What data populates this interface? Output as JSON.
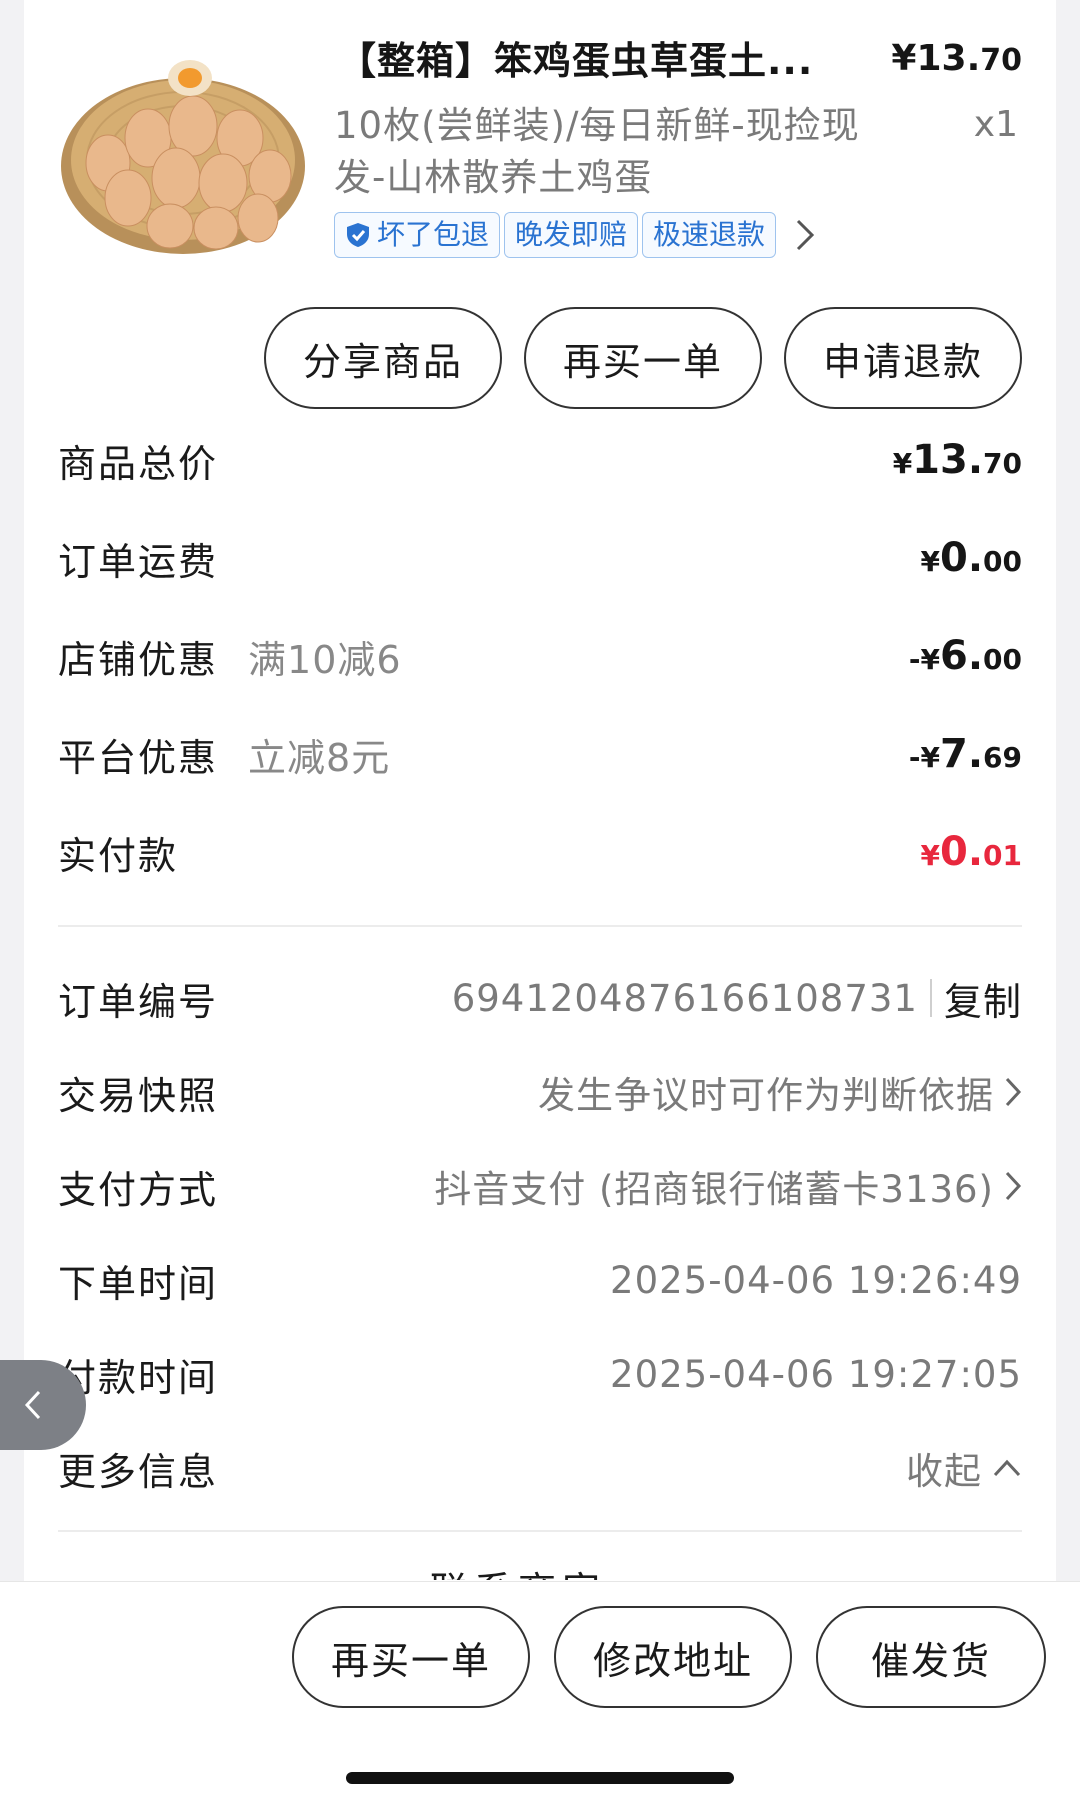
{
  "product": {
    "title": "【整箱】笨鸡蛋虫草蛋土...",
    "price_int": "¥13.",
    "price_dec": "70",
    "spec": "10枚(尝鲜装)/每日新鲜-现捡现发-山林散养土鸡蛋",
    "qty": "x1",
    "tags": [
      "坏了包退",
      "晚发即赔",
      "极速退款"
    ]
  },
  "actions": {
    "share": "分享商品",
    "rebuy": "再买一单",
    "refund": "申请退款"
  },
  "price_rows": [
    {
      "label": "商品总价",
      "sub": "",
      "sign": "",
      "sym": "¥",
      "int": "13.",
      "dec": "70"
    },
    {
      "label": "订单运费",
      "sub": "",
      "sign": "",
      "sym": "¥",
      "int": "0.",
      "dec": "00"
    },
    {
      "label": "店铺优惠",
      "sub": "满10减6",
      "sign": "-",
      "sym": "¥",
      "int": "6.",
      "dec": "00"
    },
    {
      "label": "平台优惠",
      "sub": "立减8元",
      "sign": "-",
      "sym": "¥",
      "int": "7.",
      "dec": "69"
    },
    {
      "label": "实付款",
      "sub": "",
      "sign": "",
      "sym": "¥",
      "int": "0.",
      "dec": "01"
    }
  ],
  "info_rows": {
    "order_no_label": "订单编号",
    "order_no": "6941204876166108731",
    "copy": "复制",
    "snapshot_label": "交易快照",
    "snapshot_value": "发生争议时可作为判断依据",
    "pay_method_label": "支付方式",
    "pay_method_value": "抖音支付 (招商银行储蓄卡3136)",
    "order_time_label": "下单时间",
    "order_time": "2025-04-06 19:26:49",
    "pay_time_label": "付款时间",
    "pay_time": "2025-04-06 19:27:05",
    "more_label": "更多信息",
    "collapse": "收起"
  },
  "contact_partial": "联系商家",
  "bottom": {
    "rebuy": "再买一单",
    "edit_address": "修改地址",
    "urge": "催发货"
  },
  "colors": {
    "accent_red": "#e8273d",
    "tag_blue": "#2a73d1"
  }
}
